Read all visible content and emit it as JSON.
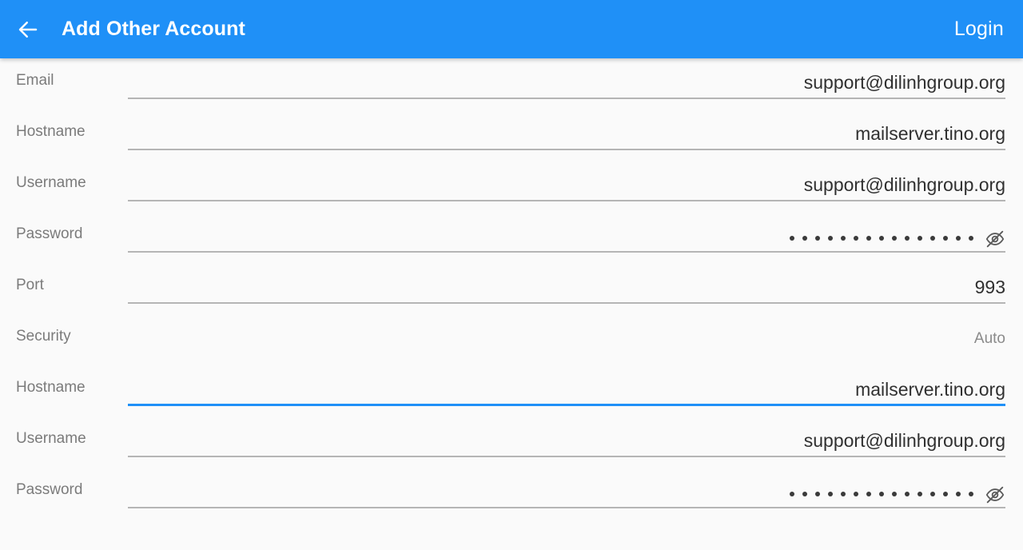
{
  "appbar": {
    "back_icon": "arrow-left-icon",
    "title": "Add Other Account",
    "action_label": "Login",
    "background_color": "#1f90f7",
    "text_color": "#ffffff"
  },
  "theme": {
    "page_background": "#fafafa",
    "label_color": "#7b7b7b",
    "value_color": "#303030",
    "underline_color": "#9e9e9e",
    "focus_color": "#1f90f7",
    "muted_value_color": "#8a8a8a"
  },
  "form": {
    "rows": [
      {
        "label": "Email",
        "value": "support@dilinhgroup.org",
        "type": "text",
        "focused": false,
        "underline": true
      },
      {
        "label": "Hostname",
        "value": "mailserver.tino.org",
        "type": "text",
        "focused": false,
        "underline": true
      },
      {
        "label": "Username",
        "value": "support@dilinhgroup.org",
        "type": "text",
        "focused": false,
        "underline": true
      },
      {
        "label": "Password",
        "value": "",
        "type": "password",
        "dot_count": 15,
        "toggle_icon": "eye-off-icon",
        "focused": false,
        "underline": true
      },
      {
        "label": "Port",
        "value": "993",
        "type": "text",
        "focused": false,
        "underline": true
      },
      {
        "label": "Security",
        "value": "Auto",
        "type": "spinner",
        "muted": true,
        "focused": false,
        "underline": false
      },
      {
        "label": "Hostname",
        "value": "mailserver.tino.org",
        "type": "text",
        "focused": true,
        "underline": true
      },
      {
        "label": "Username",
        "value": "support@dilinhgroup.org",
        "type": "text",
        "focused": false,
        "underline": true
      },
      {
        "label": "Password",
        "value": "",
        "type": "password",
        "dot_count": 15,
        "toggle_icon": "eye-off-icon",
        "focused": false,
        "underline": true
      }
    ]
  }
}
